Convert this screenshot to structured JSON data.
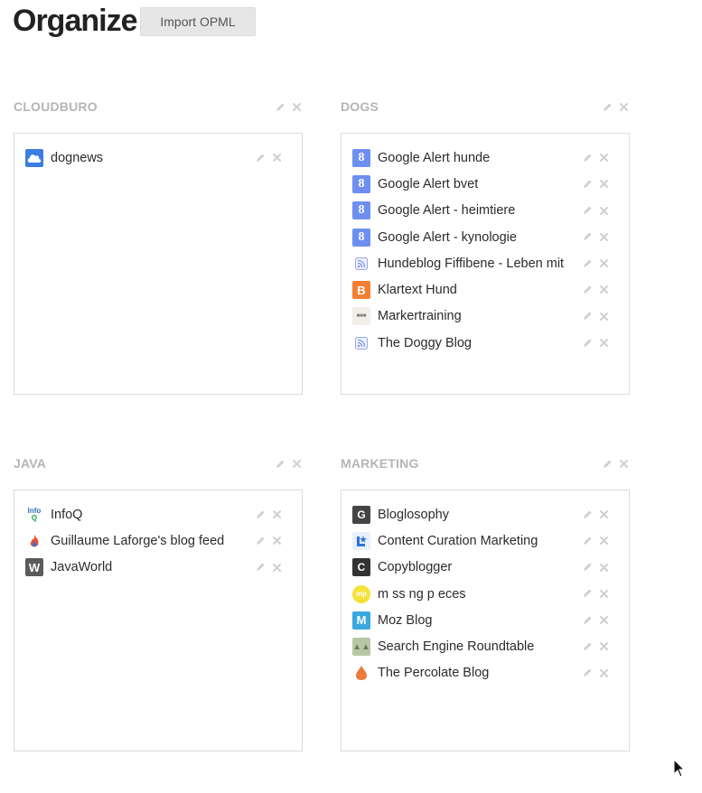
{
  "header": {
    "title": "Organize",
    "import_label": "Import OPML"
  },
  "colors": {
    "folder_label": "#b5b5b5",
    "border": "#dcdcdc",
    "control_icon": "#cfcfcf"
  },
  "folders": [
    {
      "name": "CLOUDBURO",
      "feeds": [
        {
          "label": "dognews",
          "icon": "cloud-icon"
        }
      ]
    },
    {
      "name": "DOGS",
      "feeds": [
        {
          "label": "Google Alert hunde",
          "icon": "google-icon"
        },
        {
          "label": "Google Alert bvet",
          "icon": "google-icon"
        },
        {
          "label": "Google Alert - heimtiere",
          "icon": "google-icon"
        },
        {
          "label": "Google Alert - kynologie",
          "icon": "google-icon"
        },
        {
          "label": "Hundeblog Fiffibene - Leben mit",
          "icon": "rss-icon"
        },
        {
          "label": "Klartext Hund",
          "icon": "blogger-icon"
        },
        {
          "label": "Markertraining",
          "icon": "markertraining-icon"
        },
        {
          "label": "The Doggy Blog",
          "icon": "rss-icon"
        }
      ]
    },
    {
      "name": "JAVA",
      "feeds": [
        {
          "label": "InfoQ",
          "icon": "infoq-icon"
        },
        {
          "label": "Guillaume Laforge's blog feed",
          "icon": "flame-icon"
        },
        {
          "label": "JavaWorld",
          "icon": "javaworld-icon"
        }
      ]
    },
    {
      "name": "MARKETING",
      "feeds": [
        {
          "label": "Bloglosophy",
          "icon": "bloglosophy-icon"
        },
        {
          "label": "Content Curation Marketing",
          "icon": "content-curation-icon"
        },
        {
          "label": "Copyblogger",
          "icon": "copyblogger-icon"
        },
        {
          "label": "m ss ng p eces",
          "icon": "missing-pieces-icon"
        },
        {
          "label": "Moz Blog",
          "icon": "moz-icon"
        },
        {
          "label": "Search Engine Roundtable",
          "icon": "roundtable-icon"
        },
        {
          "label": "The Percolate Blog",
          "icon": "percolate-icon"
        }
      ]
    }
  ]
}
